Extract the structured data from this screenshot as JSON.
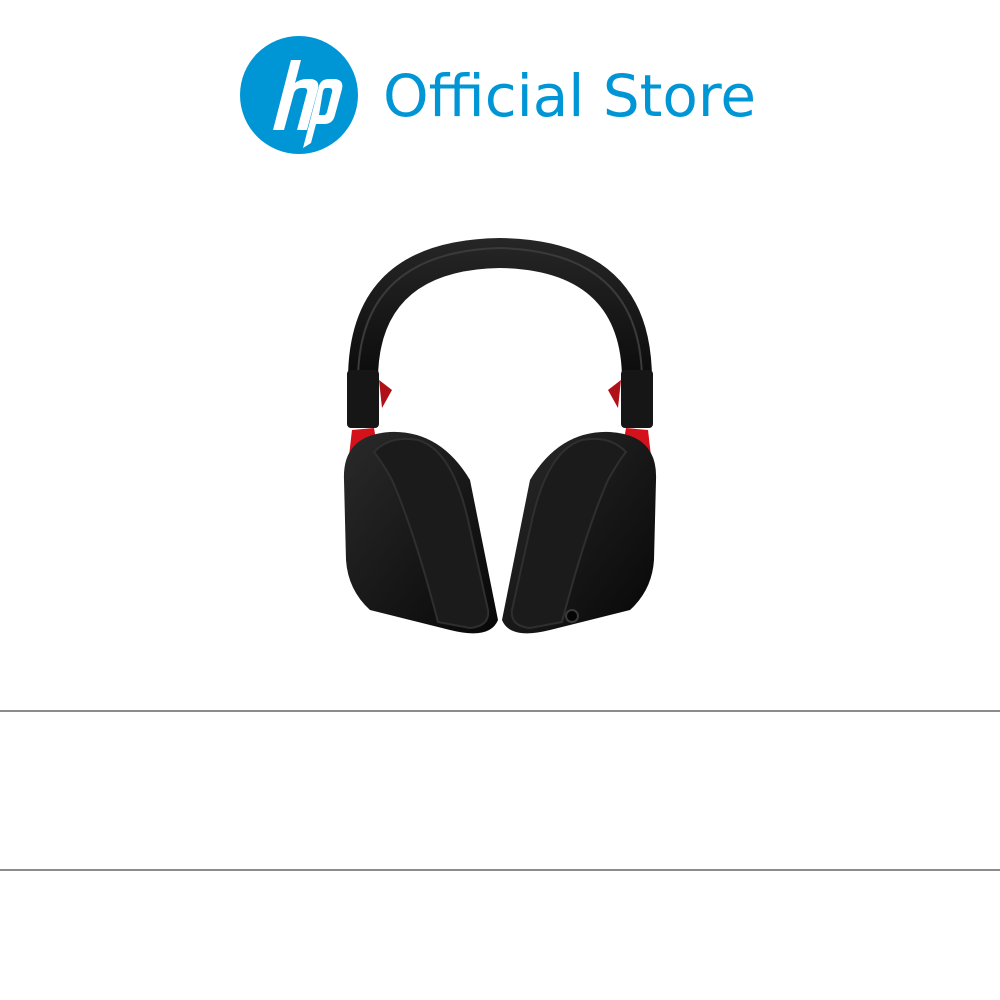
{
  "brand": {
    "logo_text": "hp",
    "title": "Official Store",
    "brand_color": "#0096D6",
    "logo_icon": "hp-logo-icon"
  },
  "product": {
    "image_icon": "headset-icon",
    "colors": {
      "body": "#141414",
      "accent": "#D4121B"
    }
  },
  "info_band": {
    "divider_color": "#8C8C8C"
  }
}
